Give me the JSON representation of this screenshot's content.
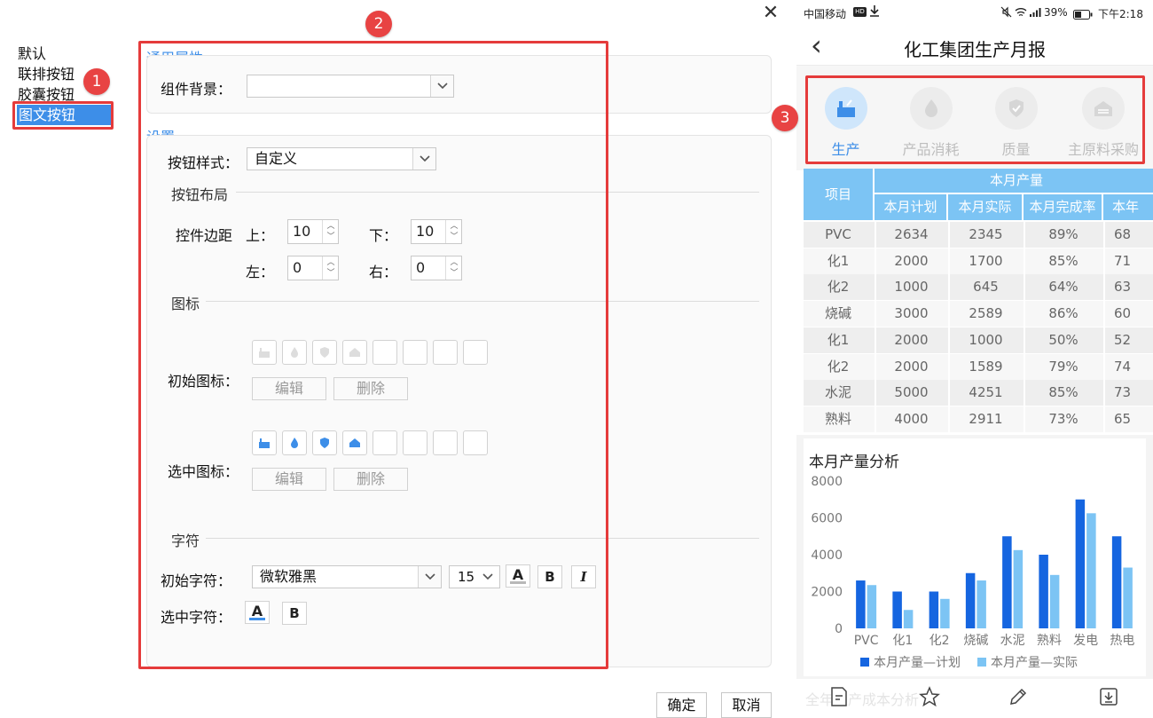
{
  "dialog": {
    "close_glyph": "✕",
    "type_list": [
      "默认",
      "联排按钮",
      "胶囊按钮",
      "图文按钮"
    ],
    "selected_type_index": 3,
    "general": {
      "title": "通用属性",
      "bg_label": "组件背景：",
      "bg_value": ""
    },
    "settings": {
      "title": "设置",
      "style_label": "按钮样式：",
      "style_value": "自定义",
      "layout_head": "按钮布局",
      "margin_label": "控件边距",
      "top_label": "上：",
      "top_value": "10",
      "bottom_label": "下：",
      "bottom_value": "10",
      "left_label": "左：",
      "left_value": "0",
      "right_label": "右：",
      "right_value": "0",
      "icon_head": "图标",
      "initial_icon_label": "初始图标：",
      "selected_icon_label": "选中图标：",
      "edit_label": "编辑",
      "delete_label": "删除",
      "char_head": "字符",
      "initial_char_label": "初始字符：",
      "font_value": "微软雅黑",
      "size_value": "15",
      "selected_char_label": "选中字符：",
      "bold_glyph": "B",
      "italic_glyph": "I",
      "color_glyph": "A"
    },
    "ok_label": "确定",
    "cancel_label": "取消"
  },
  "badges": [
    "1",
    "2",
    "3"
  ],
  "phone": {
    "status_left": "中国移动",
    "status_hd": "HD",
    "status_battery": "39%",
    "status_time": "下午2:18",
    "back_glyph": "‹",
    "title": "化工集团生产月报",
    "tabs": [
      {
        "label": "生产",
        "active": true
      },
      {
        "label": "产品消耗",
        "active": false
      },
      {
        "label": "质量",
        "active": false
      },
      {
        "label": "主原料采购",
        "active": false
      }
    ],
    "table": {
      "header_item": "项目",
      "header_group": "本月产量",
      "columns": [
        "本月计划",
        "本月实际",
        "本月完成率",
        "本年"
      ],
      "rows": [
        [
          "PVC",
          "2634",
          "2345",
          "89%",
          "68"
        ],
        [
          "化1",
          "2000",
          "1700",
          "85%",
          "71"
        ],
        [
          "化2",
          "1000",
          "645",
          "64%",
          "63"
        ],
        [
          "烧碱",
          "3000",
          "2589",
          "86%",
          "60"
        ],
        [
          "化1",
          "2000",
          "1000",
          "50%",
          "52"
        ],
        [
          "化2",
          "2000",
          "1589",
          "79%",
          "74"
        ],
        [
          "水泥",
          "5000",
          "4251",
          "85%",
          "73"
        ],
        [
          "熟料",
          "4000",
          "2911",
          "73%",
          "65"
        ]
      ]
    },
    "bottom_partial_text": "全年生产成本分析",
    "colors": {
      "accent": "#3d8ee8",
      "header": "#7cc4f4",
      "plan": "#1565e0",
      "actual": "#7cc4f4",
      "alert": "#e53b3b"
    }
  },
  "chart_data": {
    "type": "bar",
    "title": "本月产量分析",
    "categories": [
      "PVC",
      "化1",
      "化2",
      "烧碱",
      "水泥",
      "熟料",
      "发电",
      "热电"
    ],
    "series": [
      {
        "name": "本月产量—计划",
        "values": [
          2600,
          2000,
          2000,
          3000,
          5000,
          4000,
          7000,
          5000
        ]
      },
      {
        "name": "本月产量—实际",
        "values": [
          2350,
          1000,
          1600,
          2600,
          4250,
          2900,
          6250,
          3300
        ]
      }
    ],
    "yticks": [
      0,
      2000,
      4000,
      6000,
      8000
    ],
    "ylim": [
      0,
      8000
    ],
    "legend_position": "bottom",
    "grid": false
  }
}
